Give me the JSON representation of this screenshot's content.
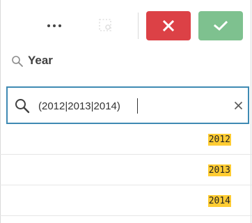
{
  "toolbar": {
    "more_icon": "more-dots-icon",
    "lasso_icon": "lasso-icon",
    "cancel_icon": "close-icon",
    "confirm_icon": "checkmark-icon",
    "cancel_color": "#dc4146",
    "confirm_color": "#7ec18f"
  },
  "field": {
    "title": "Year",
    "icon": "search-icon"
  },
  "search": {
    "value": "(2012|2013|2014)",
    "focus_color": "#3f8ab3",
    "clear_icon": "close-icon"
  },
  "list": {
    "highlight_color": "#ffcc33",
    "items": [
      {
        "label": "2012"
      },
      {
        "label": "2013"
      },
      {
        "label": "2014"
      }
    ]
  }
}
